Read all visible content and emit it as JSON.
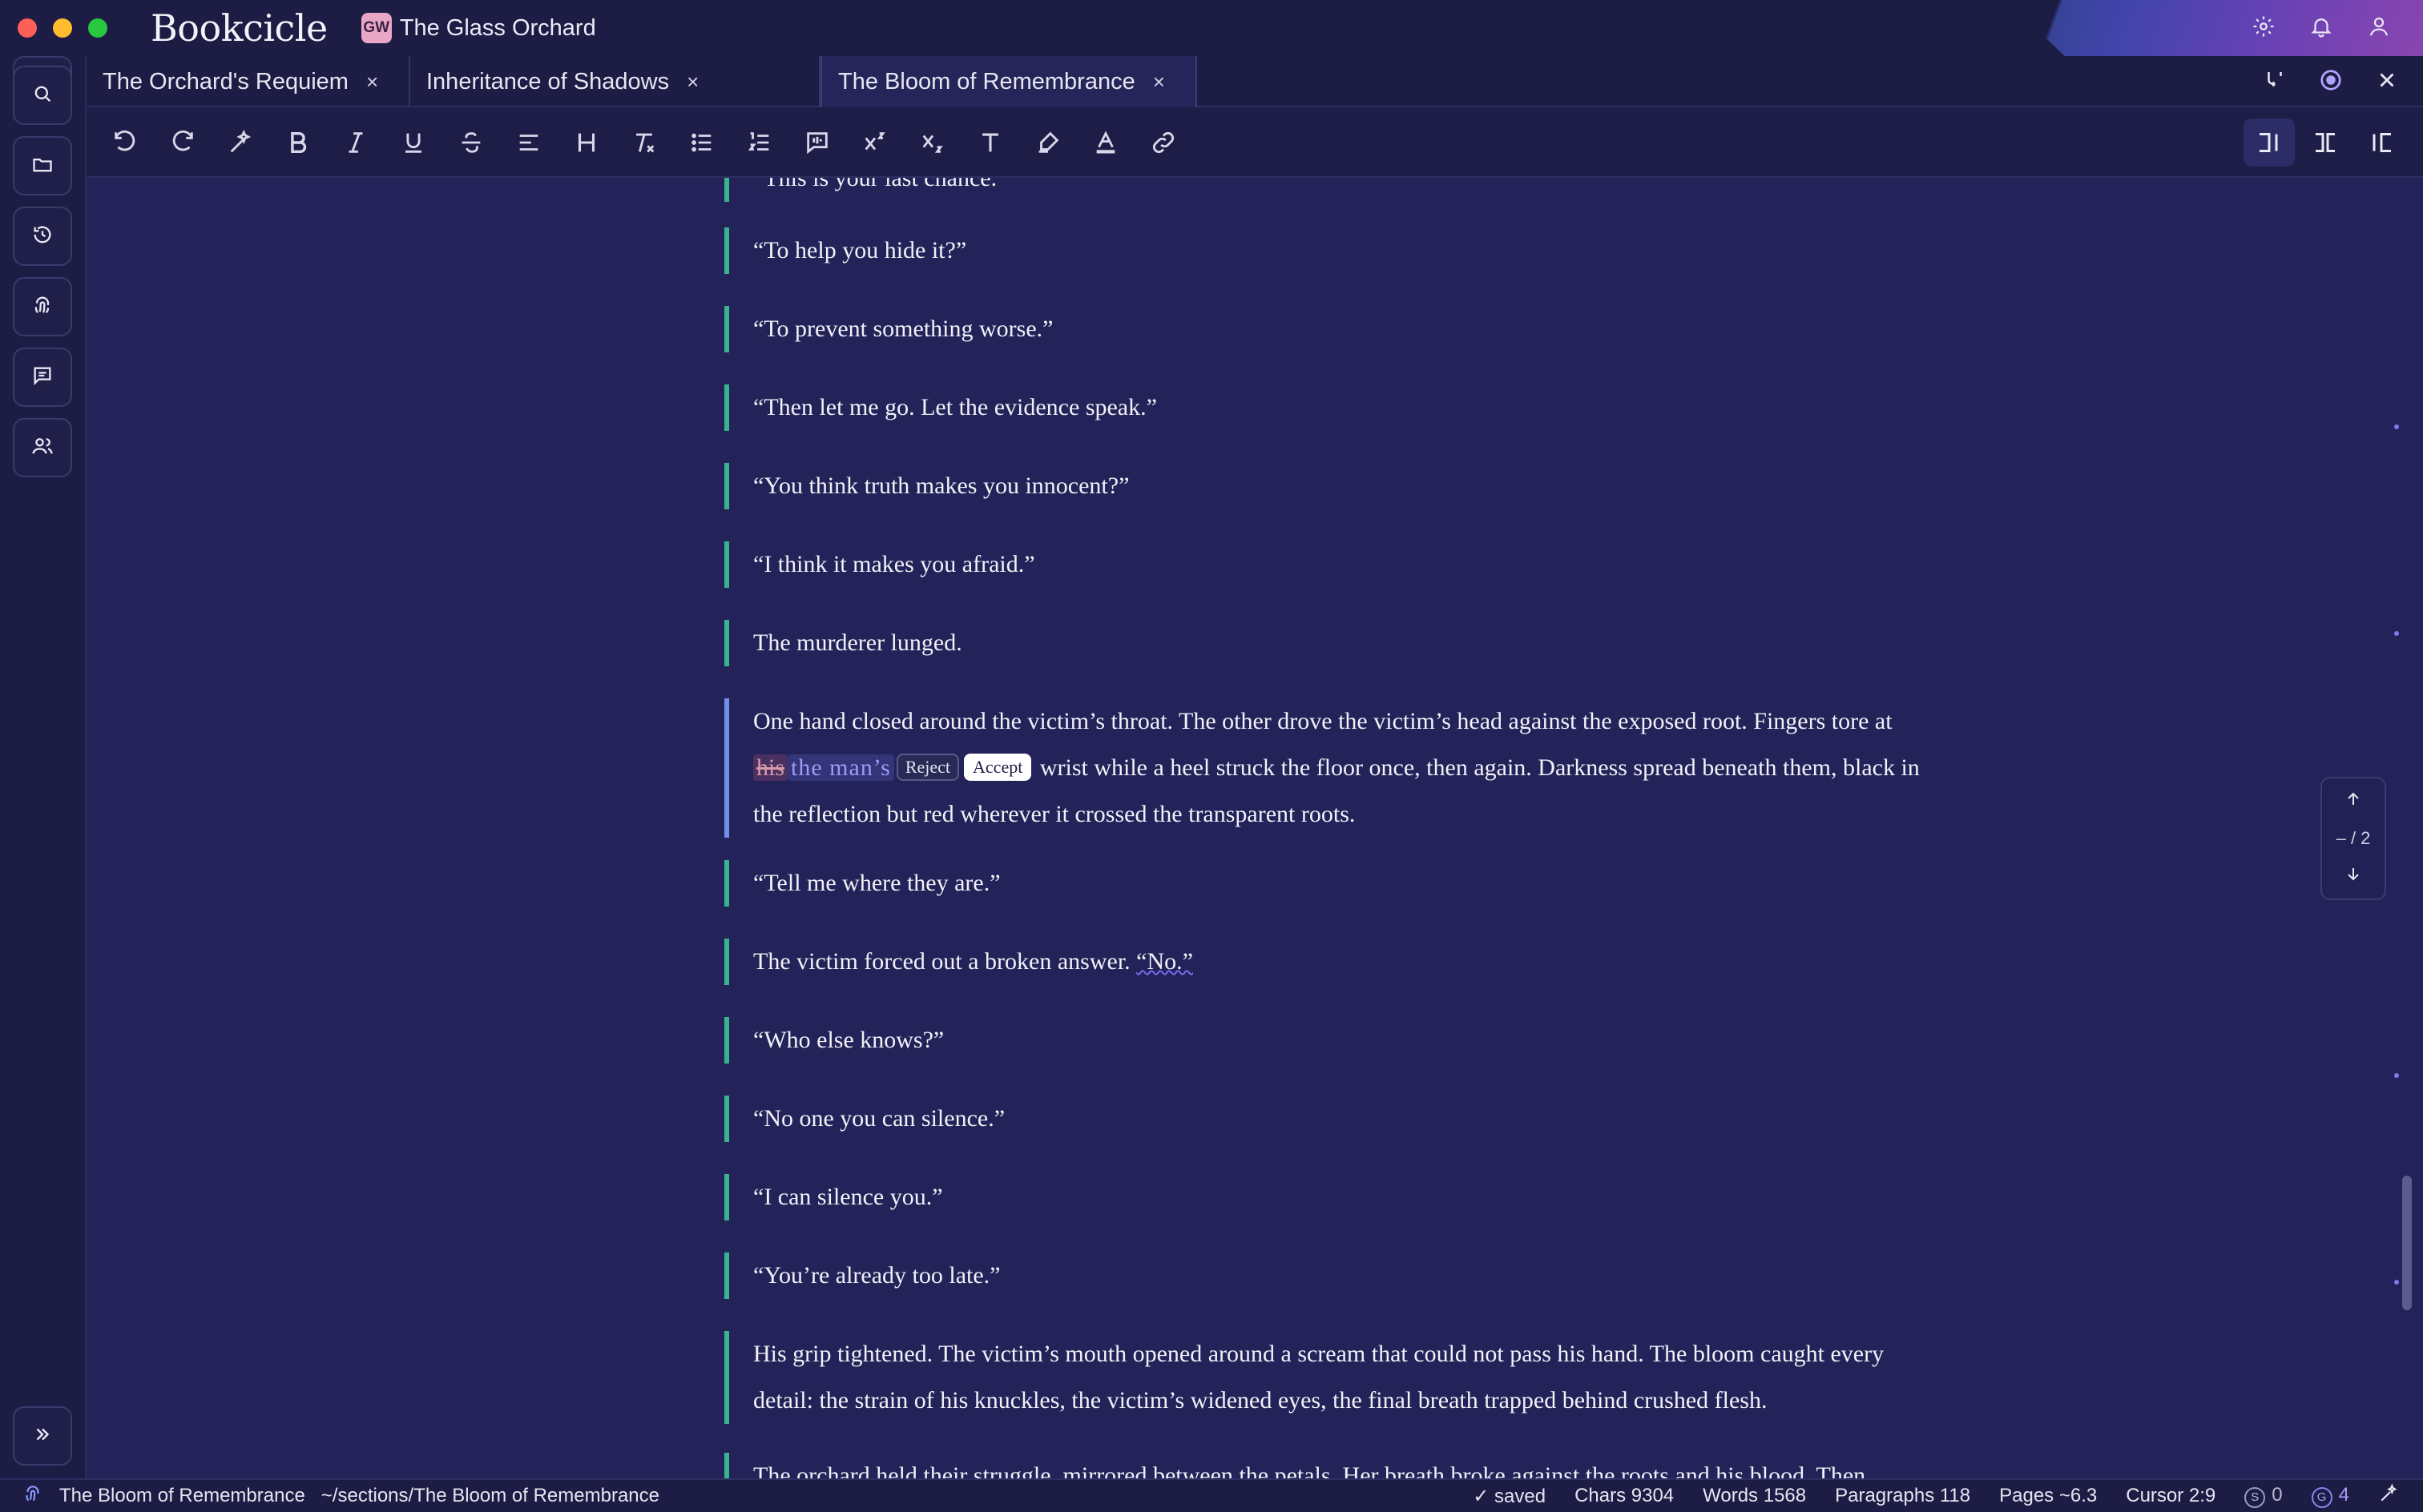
{
  "app": {
    "brand": "Bookcicle",
    "project_badge": "GW",
    "project_title": "The Glass Orchard"
  },
  "tabs": [
    {
      "label": "The Orchard's Requiem",
      "active": false
    },
    {
      "label": "Inheritance of Shadows",
      "active": false
    },
    {
      "label": "The Bloom of Remembrance",
      "active": true
    }
  ],
  "tab_close_glyph": "×",
  "editor": {
    "top_partial": "“This is your last chance.”",
    "paragraphs": [
      "“To help you hide it?”",
      "“To prevent something worse.”",
      "“Then let me go. Let the evidence speak.”",
      "“You think truth makes you innocent?”",
      "“I think it makes you afraid.”",
      "The murderer lunged."
    ],
    "suggestion_paragraph": {
      "before": "One hand closed around the victim’s throat. The other drove the victim’s head against the exposed root. Fingers tore at ",
      "deleted": "his",
      "inserted": "the man’s",
      "reject_label": "Reject",
      "accept_label": "Accept",
      "after": " wrist while a heel struck the floor once, then again. Darkness spread beneath them, black in the reflection but red wherever it crossed the transparent roots."
    },
    "paragraphs_after": [
      "“Tell me where they are.”",
      "“Who else knows?”",
      "“No one you can silence.”",
      "“I can silence you.”",
      "“You’re already too late.”"
    ],
    "victim_line_before": "The victim forced out a broken answer. ",
    "victim_line_flagged": "“No.”",
    "grip_paragraph": "His grip tightened. The victim’s mouth opened around a scream that could not pass his hand. The bloom caught every detail: the strain of his knuckles, the victim’s widened eyes, the final breath trapped behind crushed flesh.",
    "bottom_partial": "The orchard held their struggle, mirrored between the petals. Her breath broke against the roots and his blood. Then,"
  },
  "navigator": {
    "count": "– / 2"
  },
  "status": {
    "doc_name": "The Bloom of Remembrance",
    "doc_path": "~/sections/The Bloom of Remembrance",
    "saved": "✓ saved",
    "chars": "Chars 9304",
    "words": "Words 1568",
    "paragraphs": "Paragraphs 118",
    "pages": "Pages ~6.3",
    "cursor": "Cursor 2:9",
    "s_badge": "S",
    "s_count": "0",
    "g_badge": "G",
    "g_count": "4"
  },
  "colors": {
    "background": "#1d1d47",
    "editor": "#23235a",
    "accent_green": "#37b48f",
    "accent_blue": "#6f8fe8",
    "accent_purple": "#7a68f0"
  }
}
